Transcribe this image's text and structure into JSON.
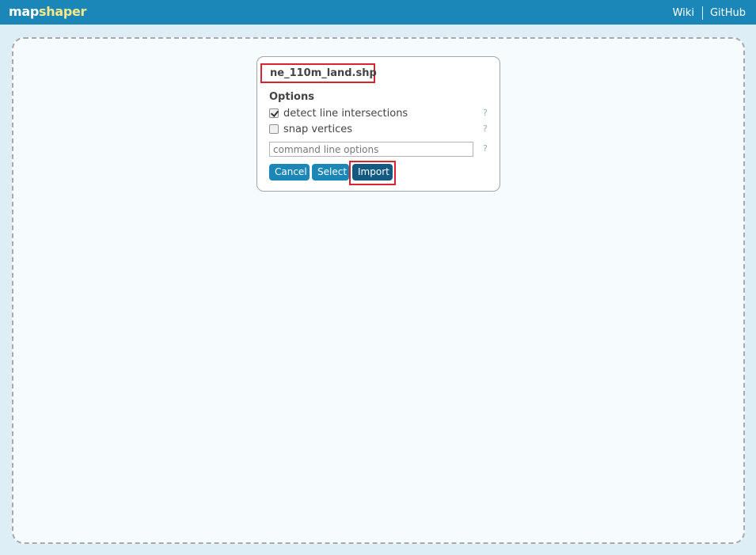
{
  "header": {
    "logo_part1": "map",
    "logo_part2": "shaper",
    "nav": {
      "wiki": "Wiki",
      "github": "GitHub"
    }
  },
  "dialog": {
    "filename": "ne_110m_land.shp",
    "options_title": "Options",
    "options": [
      {
        "label": "detect line intersections",
        "checked": true,
        "help": "?"
      },
      {
        "label": "snap vertices",
        "checked": false,
        "help": "?"
      }
    ],
    "command_input": {
      "placeholder": "command line options",
      "value": "",
      "help": "?"
    },
    "buttons": {
      "cancel": "Cancel",
      "select": "Select",
      "import": "Import"
    }
  },
  "colors": {
    "header_bg": "#1b87b8",
    "logo_accent": "#f6e98a",
    "button_bg": "#1b87b8",
    "import_button_bg": "#125a82",
    "highlight": "#d9232e"
  }
}
